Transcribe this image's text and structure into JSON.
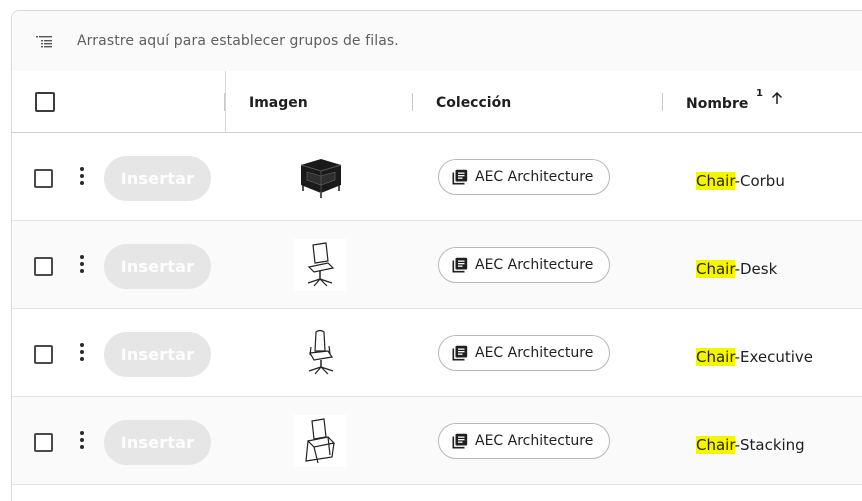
{
  "grouping": {
    "placeholder": "Arrastre aquí para establecer grupos de filas.",
    "icon": "group-rows-icon"
  },
  "header": {
    "image_label": "Imagen",
    "collection_label": "Colección",
    "name_label": "Nombre",
    "sort_index": "1",
    "sort_direction": "ascending"
  },
  "rows": [
    {
      "insert_label": "Insertar",
      "collection": "AEC Architecture",
      "name_highlight": "Chair",
      "name_rest": "-Corbu",
      "image": "armchair-thumbnail"
    },
    {
      "insert_label": "Insertar",
      "collection": "AEC Architecture",
      "name_highlight": "Chair",
      "name_rest": "-Desk",
      "image": "desk-chair-thumbnail"
    },
    {
      "insert_label": "Insertar",
      "collection": "AEC Architecture",
      "name_highlight": "Chair",
      "name_rest": "-Executive",
      "image": "executive-chair-thumbnail"
    },
    {
      "insert_label": "Insertar",
      "collection": "AEC Architecture",
      "name_highlight": "Chair",
      "name_rest": "-Stacking",
      "image": "stacking-chair-thumbnail"
    }
  ],
  "colors": {
    "highlight": "#f5f500",
    "disabled_button": "#e6e6e6",
    "border": "#d9d9d9"
  }
}
